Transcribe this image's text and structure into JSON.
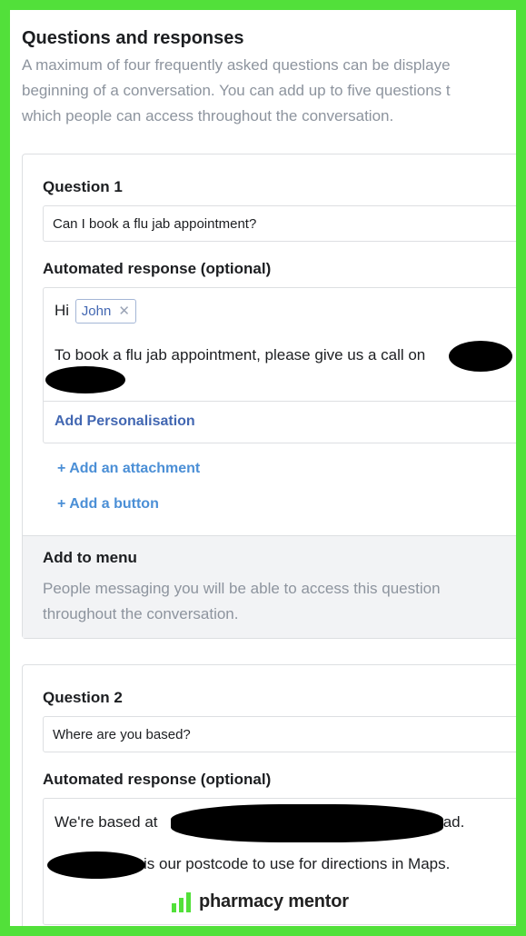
{
  "header": {
    "title": "Questions and responses",
    "description_lines": [
      "A maximum of four frequently asked questions can be displaye",
      "beginning of a conversation. You can add up to five questions t",
      "which people can access throughout the conversation."
    ]
  },
  "questions": [
    {
      "label": "Question 1",
      "value": "Can I book a flu jab appointment?",
      "response_label": "Automated response (optional)",
      "greeting": "Hi",
      "personalisation_chip": "John",
      "chip_remove_icon": "close-icon",
      "response_text": "To book a flu jab appointment, please give us a call on",
      "add_personalisation": "Add Personalisation",
      "add_attachment": "+ Add an attachment",
      "add_button": "+ Add a button",
      "menu": {
        "title": "Add to menu",
        "description": "People messaging you will be able to access this question throughout the conversation."
      }
    },
    {
      "label": "Question 2",
      "value": "Where are you based?",
      "response_label": "Automated response (optional)",
      "response_line1_start": "We're based at",
      "response_line1_end": "Road.",
      "response_line2": "is our postcode to use for directions in Maps."
    }
  ],
  "branding": {
    "name": "pharmacy mentor",
    "icon": "bar-chart-logo-icon",
    "accent_color": "#52e03a"
  }
}
